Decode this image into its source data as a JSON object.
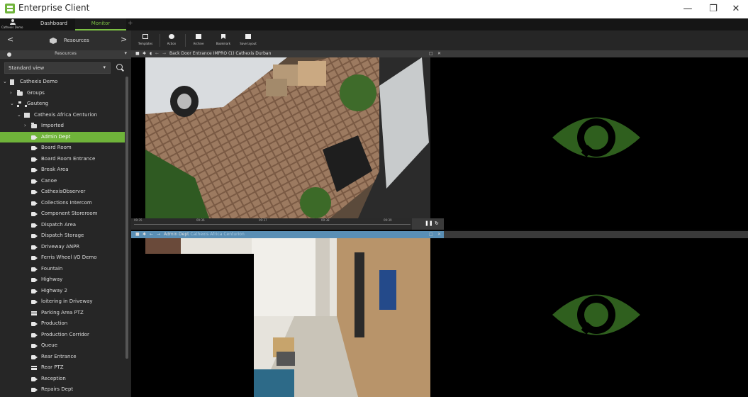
{
  "window": {
    "title": "Enterprise Client",
    "minimize": "—",
    "restore": "❐",
    "close": "✕"
  },
  "nav": {
    "user": "Cathexis Demo",
    "tabs": [
      "Dashboard",
      "Monitor"
    ],
    "add_tab": "+"
  },
  "sidebar": {
    "header_label": "Resources",
    "subheader_label": "Resources",
    "view_select": "Standard view",
    "tree": [
      {
        "label": "Cathexis Demo",
        "icon": "building-icon",
        "level": 0,
        "chevron": "expanded"
      },
      {
        "label": "Groups",
        "icon": "folder-icon",
        "level": 1,
        "chevron": "collapsed"
      },
      {
        "label": "Gauteng",
        "icon": "network-icon",
        "level": 1,
        "chevron": "expanded"
      },
      {
        "label": "Cathexis Africa Centurion",
        "icon": "server-icon",
        "level": 2,
        "chevron": "expanded"
      },
      {
        "label": "Imported",
        "icon": "folder-icon",
        "level": 3,
        "chevron": "collapsed"
      },
      {
        "label": "Admin Dept",
        "icon": "camera-icon",
        "level": 3,
        "selected": true
      },
      {
        "label": "Board Room",
        "icon": "camera-icon",
        "level": 3
      },
      {
        "label": "Board Room Entrance",
        "icon": "camera-icon",
        "level": 3
      },
      {
        "label": "Break Area",
        "icon": "camera-icon",
        "level": 3
      },
      {
        "label": "Canoe",
        "icon": "camera-icon",
        "level": 3
      },
      {
        "label": "CathexisObserver",
        "icon": "camera-icon",
        "level": 3
      },
      {
        "label": "Collections Intercom",
        "icon": "camera-icon",
        "level": 3
      },
      {
        "label": "Component Storeroom",
        "icon": "camera-icon",
        "level": 3
      },
      {
        "label": "Dispatch Area",
        "icon": "camera-icon",
        "level": 3
      },
      {
        "label": "Dispatch Storage",
        "icon": "camera-icon",
        "level": 3
      },
      {
        "label": "Driveway ANPR",
        "icon": "camera-icon",
        "level": 3
      },
      {
        "label": "Ferris Wheel I/O Demo",
        "icon": "camera-icon",
        "level": 3
      },
      {
        "label": "Fountain",
        "icon": "camera-icon",
        "level": 3
      },
      {
        "label": "Highway",
        "icon": "camera-icon",
        "level": 3
      },
      {
        "label": "Highway 2",
        "icon": "camera-icon",
        "level": 3
      },
      {
        "label": "loitering in Driveway",
        "icon": "camera-icon",
        "level": 3
      },
      {
        "label": "Parking Area PTZ",
        "icon": "ptz-camera-icon",
        "level": 3
      },
      {
        "label": "Production",
        "icon": "camera-icon",
        "level": 3
      },
      {
        "label": "Production Corridor",
        "icon": "camera-icon",
        "level": 3
      },
      {
        "label": "Queue",
        "icon": "camera-icon",
        "level": 3
      },
      {
        "label": "Rear Entrance",
        "icon": "camera-icon",
        "level": 3
      },
      {
        "label": "Rear PTZ",
        "icon": "ptz-camera-icon",
        "level": 3
      },
      {
        "label": "Reception",
        "icon": "camera-icon",
        "level": 3
      },
      {
        "label": "Repairs Dept",
        "icon": "camera-icon",
        "level": 3
      }
    ]
  },
  "toolbar": {
    "buttons": [
      "Templates",
      "Action",
      "Archive",
      "Bookmark",
      "Save layout"
    ]
  },
  "tiles": {
    "top_left": {
      "title": "Back Door Entrance IMPRO (1) Cathexis Durban",
      "subtitle": ""
    },
    "bottom_left": {
      "title": "Admin Dept",
      "subtitle": "Cathexis Africa Centurion"
    },
    "controls": {
      "maximize": "□",
      "close": "✕"
    }
  },
  "timeline": {
    "ticks": [
      "09:35",
      "09:36",
      "09:37",
      "09:38",
      "09:39"
    ],
    "pause_label": "❚❚ ↻"
  },
  "colors": {
    "accent": "#6fb33a",
    "active_header": "#5a8fb5",
    "eye_placeholder": "#2f5f1e"
  }
}
